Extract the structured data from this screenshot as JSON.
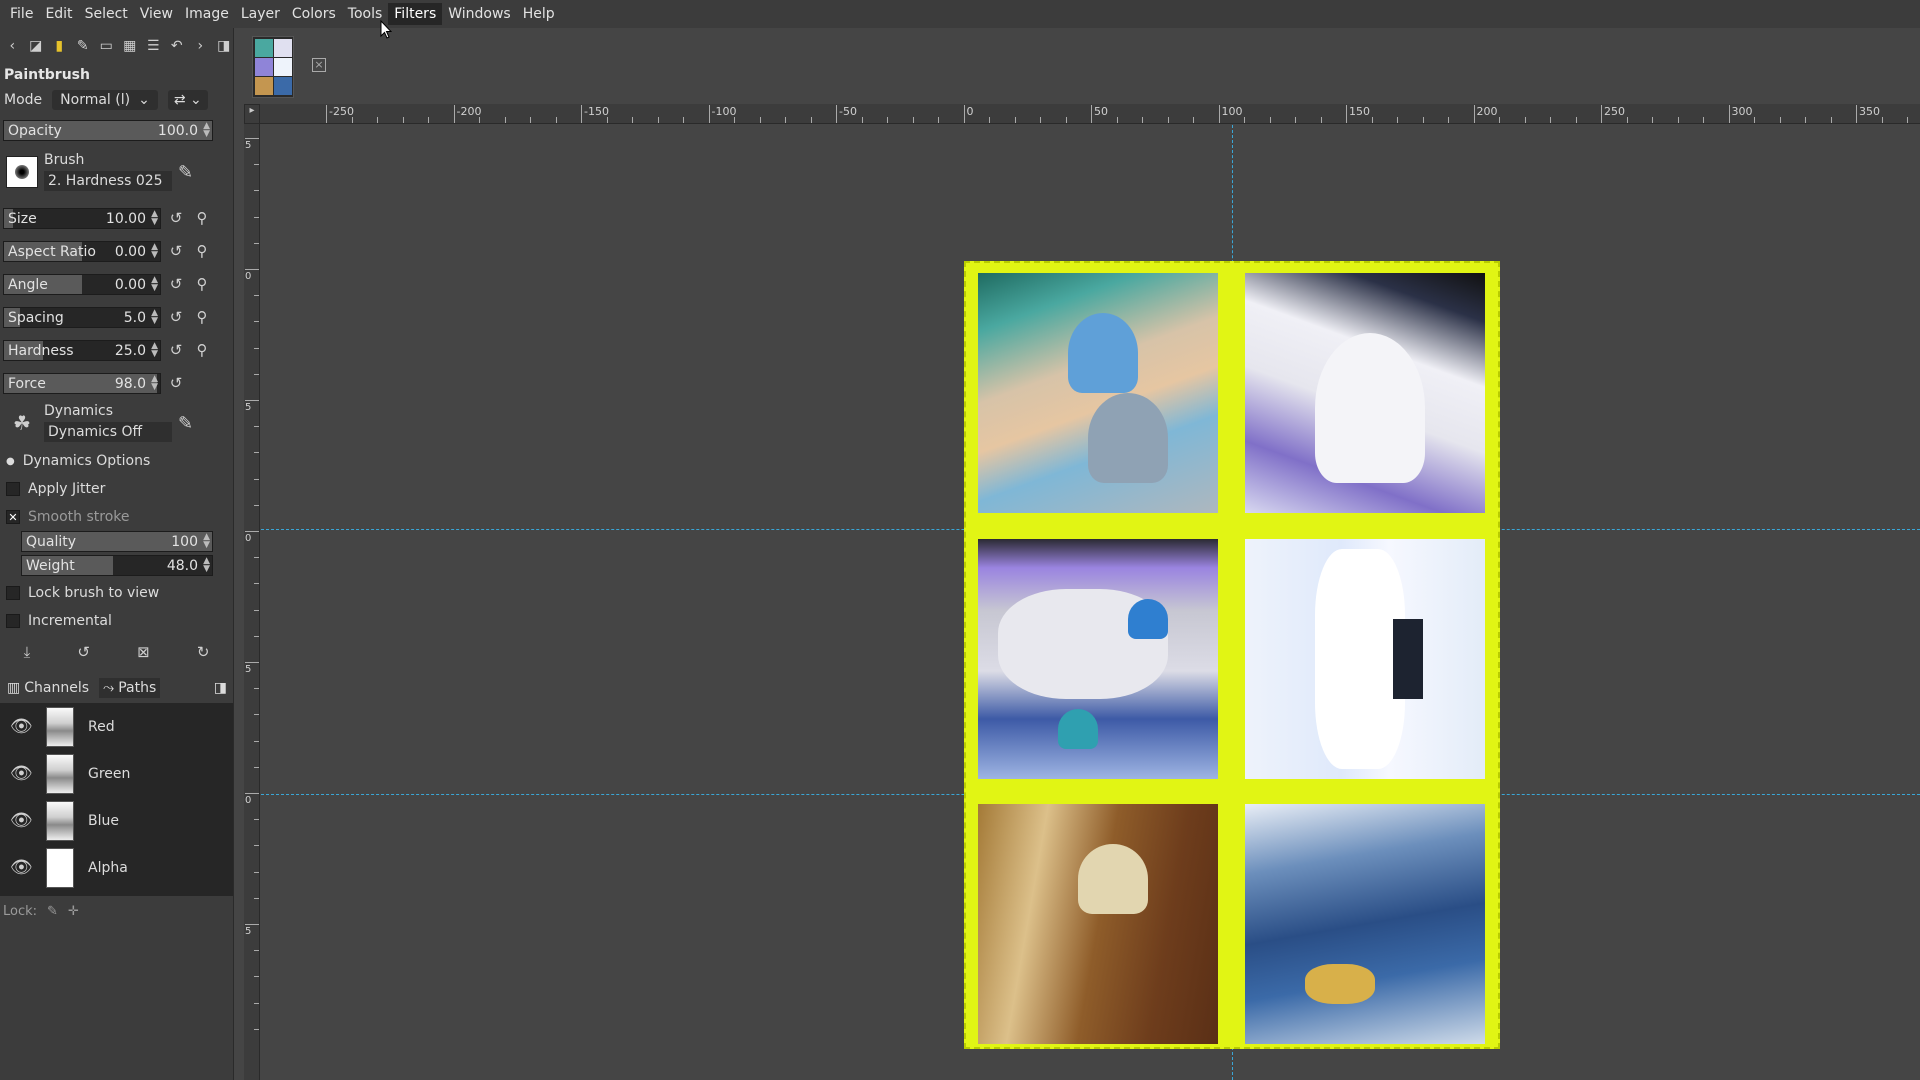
{
  "menu": {
    "items": [
      "File",
      "Edit",
      "Select",
      "View",
      "Image",
      "Layer",
      "Colors",
      "Tools",
      "Filters",
      "Windows",
      "Help"
    ],
    "active": "Filters"
  },
  "tool_options": {
    "title": "Paintbrush",
    "mode_label": "Mode",
    "mode_value": "Normal (l)",
    "opacity": {
      "label": "Opacity",
      "value": "100.0"
    },
    "brush": {
      "label": "Brush",
      "name": "2. Hardness 025"
    },
    "size": {
      "label": "Size",
      "value": "10.00"
    },
    "aspect_ratio": {
      "label": "Aspect Ratio",
      "value": "0.00"
    },
    "angle": {
      "label": "Angle",
      "value": "0.00"
    },
    "spacing": {
      "label": "Spacing",
      "value": "5.0"
    },
    "hardness": {
      "label": "Hardness",
      "value": "25.0"
    },
    "force": {
      "label": "Force",
      "value": "98.0"
    },
    "dynamics": {
      "label": "Dynamics",
      "name": "Dynamics Off"
    },
    "dynamics_options": "Dynamics Options",
    "apply_jitter": "Apply Jitter",
    "smooth_stroke": "Smooth stroke",
    "quality": {
      "label": "Quality",
      "value": "100"
    },
    "weight": {
      "label": "Weight",
      "value": "48.0"
    },
    "lock_brush": "Lock brush to view",
    "incremental": "Incremental"
  },
  "channels": {
    "tab_channels": "Channels",
    "tab_paths": "Paths",
    "items": [
      {
        "name": "Red"
      },
      {
        "name": "Green"
      },
      {
        "name": "Blue"
      },
      {
        "name": "Alpha"
      }
    ],
    "lock_label": "Lock:"
  },
  "ruler": {
    "h_labels": [
      "-250",
      "-200",
      "-150",
      "-100",
      "-50",
      "0",
      "50",
      "100",
      "150",
      "200",
      "250",
      "300",
      "350"
    ],
    "v_labels": [
      "5",
      "0",
      "5",
      "0",
      "5",
      "0",
      "5"
    ]
  },
  "colors": {
    "frame": "#e1f514",
    "guide": "#3aa6d6",
    "canvas_bg": "#454545"
  }
}
